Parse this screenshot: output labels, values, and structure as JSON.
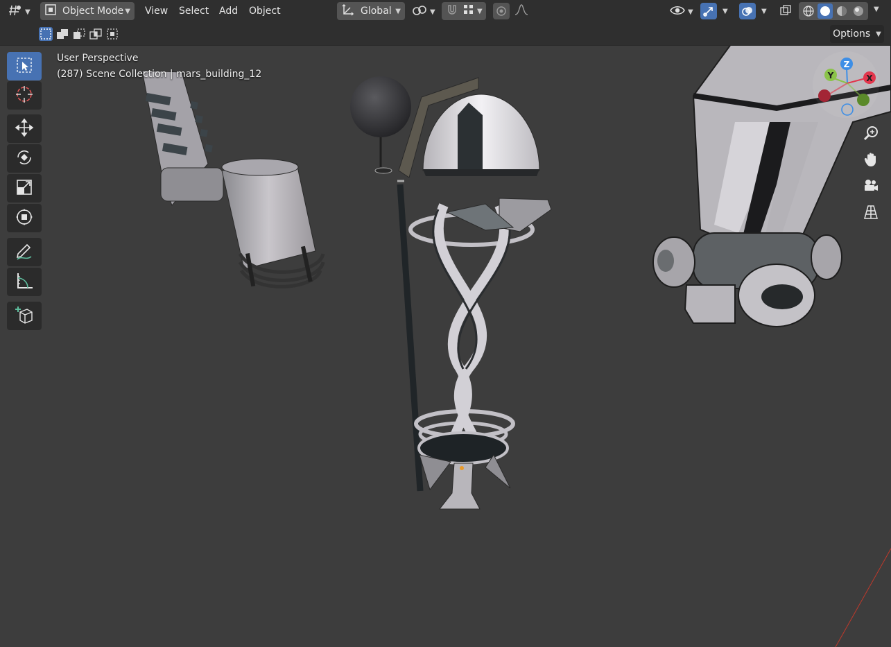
{
  "header": {
    "editor_type_icon": "viewport-grid-icon",
    "mode": "Object Mode",
    "menus": [
      "View",
      "Select",
      "Add",
      "Object"
    ],
    "transform_orientation": "Global",
    "options_label": "Options"
  },
  "viewport": {
    "perspective_label": "User Perspective",
    "collection_label": "(287) Scene Collection | mars_building_12"
  },
  "toolbar": {
    "tools": [
      "select-box",
      "cursor",
      "move",
      "rotate",
      "scale",
      "transform",
      "annotate",
      "measure",
      "add-cube"
    ],
    "active_tool": "select-box"
  },
  "gizmo": {
    "axes": [
      "Z",
      "Y",
      "X"
    ]
  },
  "colors": {
    "header_bg": "#2f2f2f",
    "viewport_bg": "#3d3d3d",
    "active_blue": "#4772b3",
    "axis_x": "#e2364c",
    "axis_y": "#8bc34a",
    "axis_z": "#3d8ee6"
  }
}
